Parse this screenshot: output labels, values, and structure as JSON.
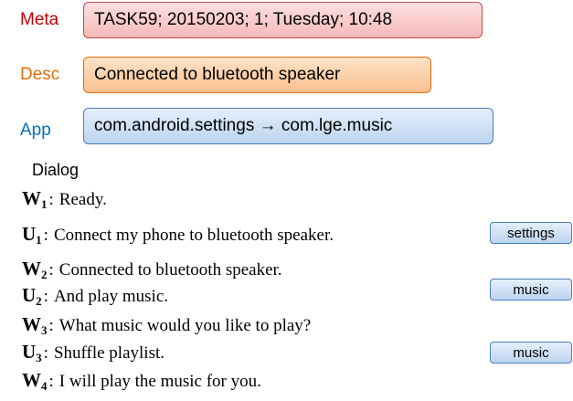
{
  "meta": {
    "label": "Meta",
    "value": "TASK59; 20150203; 1; Tuesday; 10:48",
    "color": "#c00000"
  },
  "desc": {
    "label": "Desc",
    "value": "Connected to bluetooth speaker",
    "color": "#e46c0a"
  },
  "app": {
    "label": "App",
    "value": "com.android.settings → com.lge.music",
    "color": "#0070c0"
  },
  "dialog": {
    "title": "Dialog",
    "turns": [
      {
        "speaker": "W",
        "index": "1",
        "text": "Ready.",
        "tag": ""
      },
      {
        "speaker": "U",
        "index": "1",
        "text": "Connect my phone to bluetooth speaker.",
        "tag": "settings"
      },
      {
        "speaker": "W",
        "index": "2",
        "text": "Connected to bluetooth speaker.",
        "tag": ""
      },
      {
        "speaker": "U",
        "index": "2",
        "text": "And play music.",
        "tag": "music"
      },
      {
        "speaker": "W",
        "index": "3",
        "text": "What music would you like to play?",
        "tag": ""
      },
      {
        "speaker": "U",
        "index": "3",
        "text": "Shuffle playlist.",
        "tag": "music"
      },
      {
        "speaker": "W",
        "index": "4",
        "text": "I will play the music for you.",
        "tag": ""
      }
    ]
  }
}
